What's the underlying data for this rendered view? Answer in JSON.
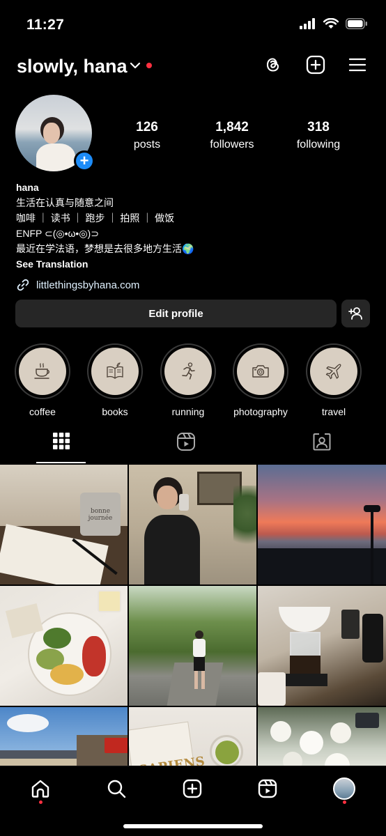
{
  "status_bar": {
    "time": "11:27"
  },
  "header": {
    "username": "slowly, hana"
  },
  "profile": {
    "stats": [
      {
        "value": "126",
        "label": "posts"
      },
      {
        "value": "1,842",
        "label": "followers"
      },
      {
        "value": "318",
        "label": "following"
      }
    ],
    "add_story_glyph": "+",
    "bio": {
      "name": "hana",
      "lines": [
        "生活在认真与随意之间",
        "咖啡 ｜ 读书 ｜ 跑步 ｜ 拍照 ｜ 做饭",
        "ENFP ⊂(◎•ω•◎)⊃",
        "最近在学法语，梦想是去很多地方生活🌍"
      ],
      "see_translation": "See Translation"
    },
    "link": "littlethingsbyhana.com",
    "edit_profile_label": "Edit profile"
  },
  "highlights": [
    {
      "label": "coffee",
      "icon": "coffee-cup-icon"
    },
    {
      "label": "books",
      "icon": "open-book-icon"
    },
    {
      "label": "running",
      "icon": "runner-icon"
    },
    {
      "label": "photography",
      "icon": "camera-icon"
    },
    {
      "label": "travel",
      "icon": "airplane-icon"
    }
  ],
  "tabs": [
    {
      "name": "posts-grid",
      "icon": "grid-icon",
      "active": true
    },
    {
      "name": "reels",
      "icon": "reels-icon",
      "active": false
    },
    {
      "name": "tagged",
      "icon": "tagged-person-icon",
      "active": false
    }
  ],
  "grid_images": [
    {
      "thumb_text": "bonne journée"
    },
    {
      "thumb_text": ""
    },
    {
      "thumb_text": ""
    },
    {
      "thumb_text": ""
    },
    {
      "thumb_text": ""
    },
    {
      "thumb_text": ""
    },
    {
      "thumb_text": ""
    },
    {
      "thumb_text": "SAPIENS"
    },
    {
      "thumb_text": ""
    }
  ],
  "bottom_nav": [
    {
      "name": "home",
      "icon": "home-icon",
      "notify": true
    },
    {
      "name": "search",
      "icon": "search-icon",
      "notify": false
    },
    {
      "name": "create",
      "icon": "plus-square-icon",
      "notify": false
    },
    {
      "name": "reels",
      "icon": "reels-icon",
      "notify": false
    },
    {
      "name": "profile",
      "icon": "profile-avatar",
      "notify": true
    }
  ],
  "colors": {
    "background": "#000000",
    "button_bg": "#262626",
    "accent_blue": "#1d8cf8",
    "notification_red": "#ff3040",
    "highlight_cover": "#d9cfc2"
  }
}
